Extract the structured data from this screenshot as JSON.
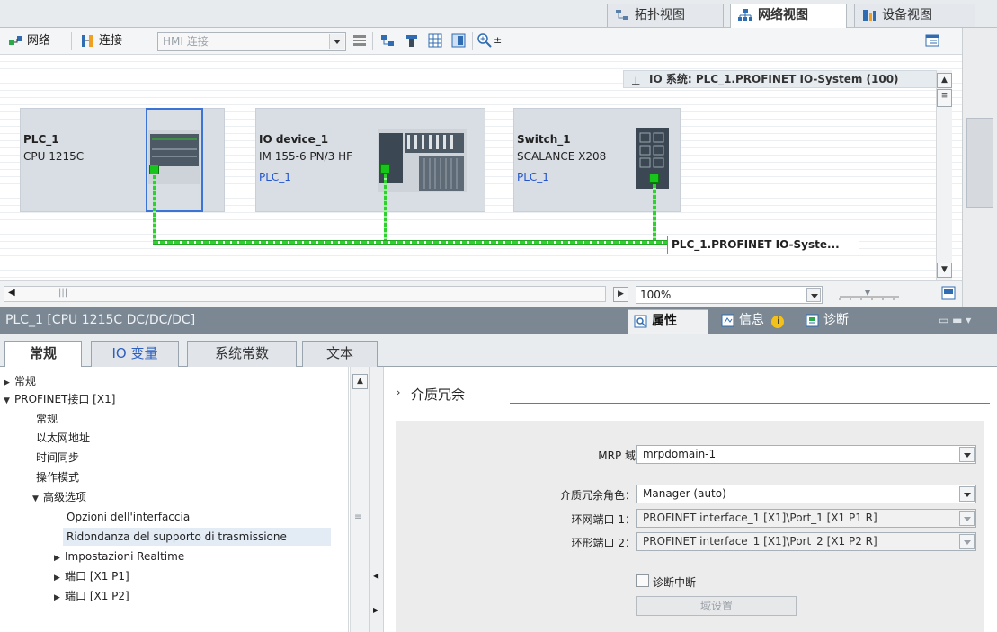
{
  "view_tabs": [
    {
      "label": "拓扑视图",
      "icon": "topology-icon"
    },
    {
      "label": "网络视图",
      "icon": "network-icon"
    },
    {
      "label": "设备视图",
      "icon": "device-icon"
    }
  ],
  "toolbar": {
    "network_label": "网络",
    "connect_label": "连接",
    "hmi_combo_value": "HMI 连接"
  },
  "io_system_info": "IO 系统: PLC_1.PROFINET IO-System (100)",
  "devices": [
    {
      "name": "PLC_1",
      "type": "CPU 1215C",
      "link": ""
    },
    {
      "name": "IO device_1",
      "type": "IM 155-6 PN/3 HF",
      "link": "PLC_1"
    },
    {
      "name": "Switch_1",
      "type": "SCALANCE X208",
      "link": "PLC_1"
    }
  ],
  "network_label": "PLC_1.PROFINET IO-Syste...",
  "zoom_value": "100%",
  "inspector": {
    "title": "PLC_1 [CPU 1215C DC/DC/DC]",
    "tabs": [
      {
        "label": "属性",
        "icon": "properties-icon"
      },
      {
        "label": "信息",
        "icon": "info-icon"
      },
      {
        "label": "诊断",
        "icon": "diagnostics-icon"
      }
    ]
  },
  "property_tabs": [
    "常规",
    "IO 变量",
    "系统常数",
    "文本"
  ],
  "tree": [
    {
      "label": "常规",
      "arrow": "▶"
    },
    {
      "label": "PROFINET接口 [X1]",
      "arrow": "▼"
    },
    {
      "label": "常规",
      "arrow": ""
    },
    {
      "label": "以太网地址",
      "arrow": ""
    },
    {
      "label": "时间同步",
      "arrow": ""
    },
    {
      "label": "操作模式",
      "arrow": ""
    },
    {
      "label": "高级选项",
      "arrow": "▼"
    },
    {
      "label": "Opzioni dell'interfaccia",
      "arrow": ""
    },
    {
      "label": "Ridondanza del supporto di trasmissione",
      "arrow": ""
    },
    {
      "label": "Impostazioni Realtime",
      "arrow": "▶"
    },
    {
      "label": "端口 [X1 P1]",
      "arrow": "▶"
    },
    {
      "label": "端口 [X1 P2]",
      "arrow": "▶"
    }
  ],
  "section": {
    "title": "介质冗余",
    "fields": [
      {
        "label": "MRP 域",
        "value": "mrpdomain-1"
      },
      {
        "label": "介质冗余角色：",
        "value": "Manager (auto)"
      },
      {
        "label": "环网端口 1：",
        "value": "PROFINET interface_1 [X1]\\Port_1 [X1 P1 R]"
      },
      {
        "label": "环形端口 2：",
        "value": "PROFINET interface_1 [X1]\\Port_2 [X1 P2 R]"
      }
    ],
    "checkbox_label": "诊断中断",
    "domain_button": "域设置"
  }
}
